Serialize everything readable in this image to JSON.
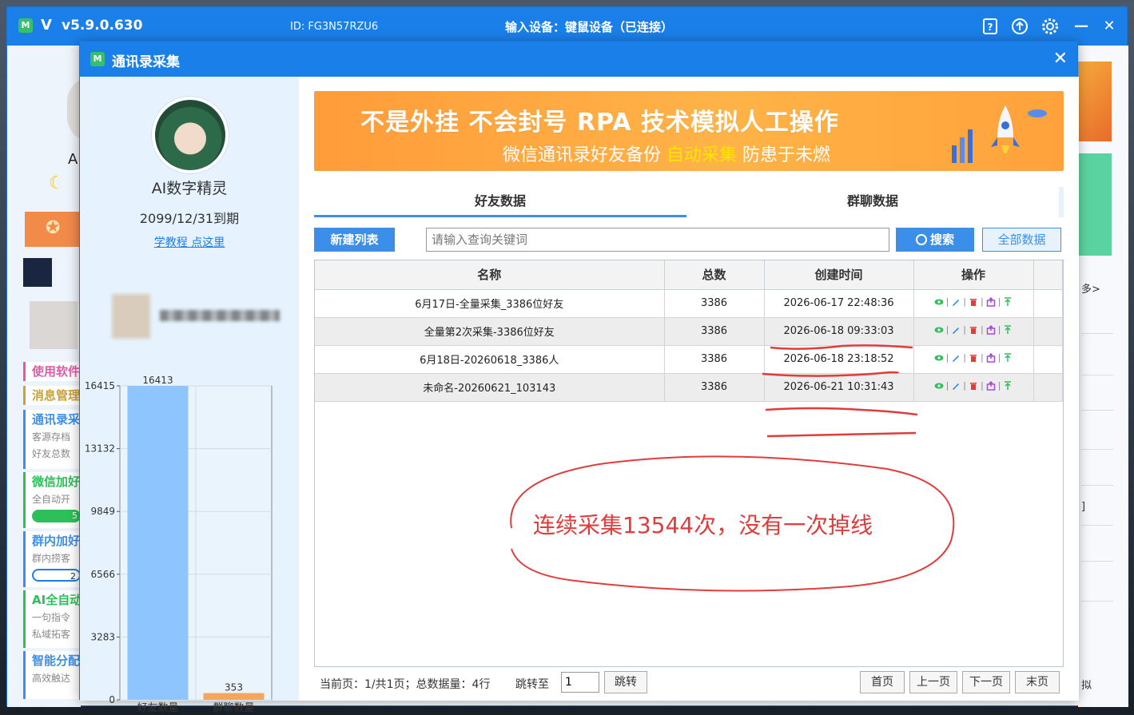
{
  "main": {
    "app_name": "V",
    "version": "v5.9.0.630",
    "device_id": "ID: FG3N57RZU6",
    "input_device": "输入设备：键鼠设备（已连接）",
    "left_letter": "A",
    "menu": [
      {
        "title": "使用软件",
        "subs": [],
        "color": "#e05aa8"
      },
      {
        "title": "消息管理",
        "subs": [],
        "color": "#c9a23a"
      },
      {
        "title": "通讯录采",
        "subs": [
          "客源存档",
          "好友总数"
        ],
        "color": "#3c8fe8"
      },
      {
        "title": "微信加好",
        "subs": [
          "全自动开"
        ],
        "progress": "5",
        "color": "#2fbf5a"
      },
      {
        "title": "群内加好",
        "subs": [
          "群内捞客"
        ],
        "progress": "2",
        "color": "#3c8fe8"
      },
      {
        "title": "AI全自动",
        "subs": [
          "一句指令",
          "私域拓客"
        ],
        "color": "#2fbf5a"
      },
      {
        "title": "智能分配",
        "subs": [
          "高效触达"
        ],
        "color": "#3c8fe8"
      }
    ],
    "right_more": "多>",
    "right_frag1": "]",
    "right_frag2": "拟"
  },
  "dialog": {
    "title": "通讯录采集",
    "profile": {
      "name": "AI数字精灵",
      "expire": "2099/12/31到期",
      "tutorial_link": "学教程 点这里"
    },
    "banner": {
      "line1": "不是外挂 不会封号 RPA 技术模拟人工操作",
      "line2_a": "微信通讯录好友备份 ",
      "line2_hl": "自动采集",
      "line2_b": " 防患于未燃"
    },
    "tabs": {
      "friends": "好友数据",
      "groups": "群聊数据"
    },
    "toolbar": {
      "new_list": "新建列表",
      "search_placeholder": "请输入查询关键词",
      "search": "搜索",
      "all_data": "全部数据"
    },
    "table": {
      "headers": [
        "名称",
        "总数",
        "创建时间",
        "操作"
      ],
      "rows": [
        {
          "name": "6月17日-全量采集_3386位好友",
          "total": "3386",
          "created": "2026-06-17 22:48:36"
        },
        {
          "name": "全量第2次采集-3386位好友",
          "total": "3386",
          "created": "2026-06-18 09:33:03"
        },
        {
          "name": "6月18日-20260618_3386人",
          "total": "3386",
          "created": "2026-06-18 23:18:52"
        },
        {
          "name": "未命名-20260621_103143",
          "total": "3386",
          "created": "2026-06-21 10:31:43"
        }
      ]
    },
    "annotation": "连续采集13544次，没有一次掉线",
    "pager": {
      "info": "当前页：1/共1页；总数据量：4行",
      "jump_label": "跳转至",
      "jump_value": "1",
      "jump_btn": "跳转",
      "first": "首页",
      "prev": "上一页",
      "next": "下一页",
      "last": "末页"
    }
  },
  "chart_data": {
    "type": "bar",
    "categories": [
      "好友数量",
      "群聊数量"
    ],
    "values": [
      16413,
      353
    ],
    "y_ticks": [
      "0",
      "3283",
      "6566",
      "9849",
      "13132",
      "16415"
    ],
    "ylim": [
      0,
      16415
    ],
    "colors": [
      "#8ec5ff",
      "#f5a55c"
    ]
  }
}
